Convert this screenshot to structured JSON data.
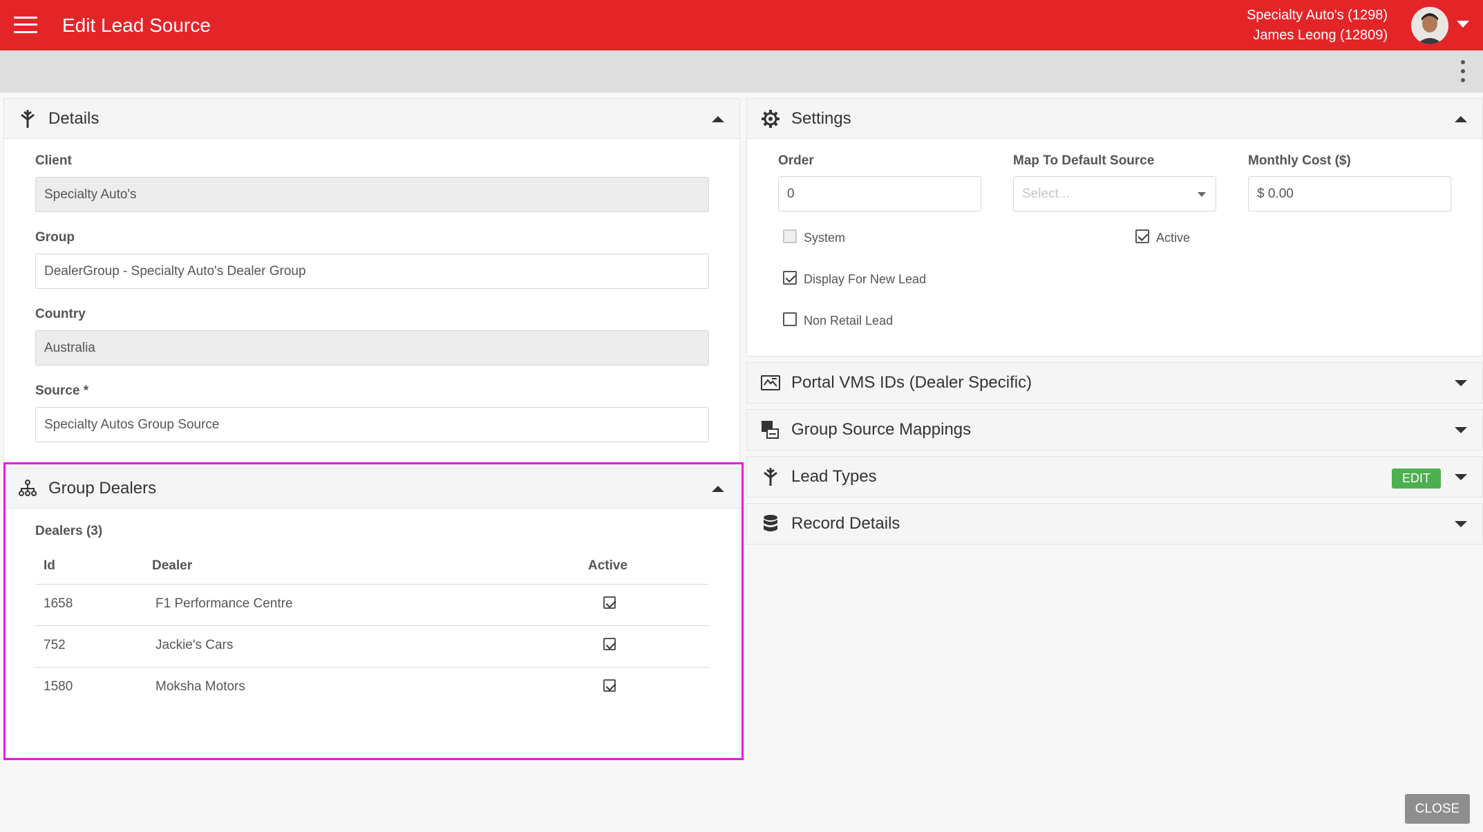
{
  "header": {
    "title": "Edit Lead Source",
    "client_line": "Specialty Auto's (1298)",
    "user_line": "James Leong (12809)",
    "accent": "#e42528"
  },
  "details": {
    "title": "Details",
    "icon": "funnel-icon",
    "client_label": "Client",
    "client_value": "Specialty Auto's",
    "group_label": "Group",
    "group_value": "DealerGroup - Specialty Auto's Dealer Group",
    "country_label": "Country",
    "country_value": "Australia",
    "source_label": "Source *",
    "source_value": "Specialty Autos Group Source"
  },
  "group_dealers": {
    "title": "Group Dealers",
    "icon": "hierarchy-icon",
    "count_label": "Dealers (3)",
    "columns": [
      "Id",
      "Dealer",
      "Active"
    ],
    "rows": [
      {
        "id": "1658",
        "dealer": "F1 Performance Centre",
        "active": true
      },
      {
        "id": "752",
        "dealer": "Jackie's Cars",
        "active": true
      },
      {
        "id": "1580",
        "dealer": "Moksha Motors",
        "active": true
      }
    ]
  },
  "settings": {
    "title": "Settings",
    "icon": "gear-icon",
    "order_label": "Order",
    "order_value": "0",
    "map_label": "Map To Default Source",
    "map_placeholder": "Select...",
    "cost_label": "Monthly Cost ($)",
    "cost_value": "$ 0.00",
    "system_label": "System",
    "active_label": "Active",
    "display_label": "Display For New Lead",
    "non_retail_label": "Non Retail Lead"
  },
  "collapsed_panels": {
    "portal": "Portal VMS IDs (Dealer Specific)",
    "mappings": "Group Source Mappings",
    "lead_types": "Lead Types",
    "record": "Record Details",
    "edit_label": "EDIT"
  },
  "footer": {
    "close_label": "CLOSE"
  }
}
